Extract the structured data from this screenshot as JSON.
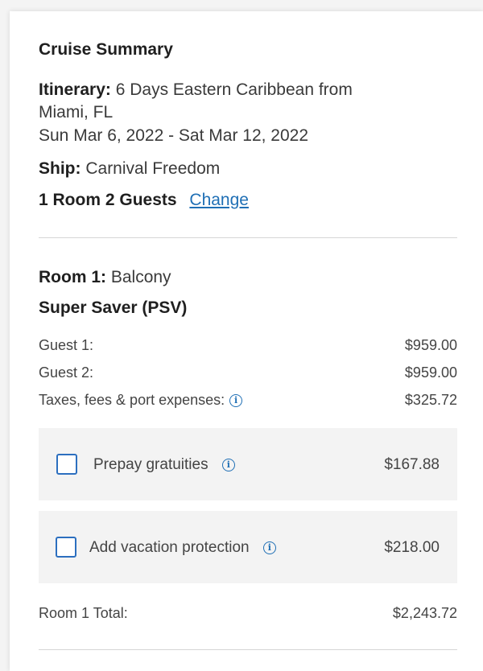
{
  "summary": {
    "title": "Cruise Summary",
    "itinerary_label": "Itinerary:",
    "itinerary_line1": "6 Days Eastern Caribbean from",
    "itinerary_line2": "Miami, FL",
    "dates": "Sun Mar 6, 2022 - Sat Mar 12, 2022",
    "ship_label": "Ship:",
    "ship_value": "Carnival Freedom",
    "rooms_guests": "1 Room 2 Guests",
    "change_link": "Change"
  },
  "room": {
    "room_label": "Room 1:",
    "room_type": "Balcony",
    "fare": "Super Saver (PSV)",
    "lines": [
      {
        "label": "Guest 1:",
        "value": "$959.00"
      },
      {
        "label": "Guest 2:",
        "value": "$959.00"
      },
      {
        "label": "Taxes, fees & port expenses:",
        "value": "$325.72"
      }
    ],
    "addons": [
      {
        "label": "Prepay gratuities",
        "value": "$167.88",
        "checked": false
      },
      {
        "label": "Add vacation protection",
        "value": "$218.00",
        "checked": false
      }
    ],
    "total_label": "Room 1 Total:",
    "total_value": "$2,243.72"
  },
  "icons": {
    "info": "info-icon"
  },
  "colors": {
    "link": "#1f6fb5",
    "checkbox_border": "#2c6fbf",
    "addon_bg": "#f3f3f3"
  }
}
